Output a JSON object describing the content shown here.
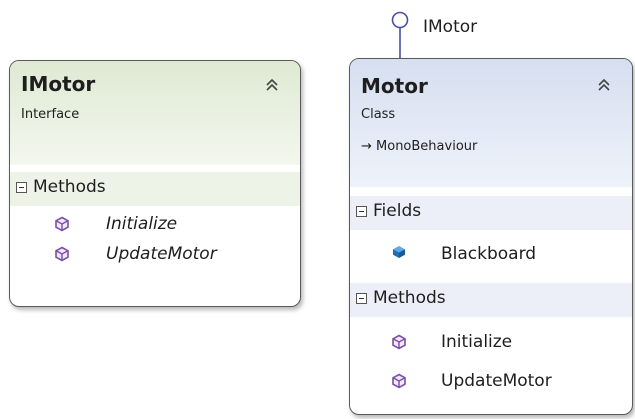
{
  "lollipop": {
    "label": "IMotor"
  },
  "imotor": {
    "name": "IMotor",
    "stereotype": "Interface",
    "methods": {
      "label": "Methods",
      "items": [
        "Initialize",
        "UpdateMotor"
      ]
    }
  },
  "motor": {
    "name": "Motor",
    "stereotype": "Class",
    "inherits": "→ MonoBehaviour",
    "fields": {
      "label": "Fields",
      "items": [
        "Blackboard"
      ]
    },
    "methods": {
      "label": "Methods",
      "items": [
        "Initialize",
        "UpdateMotor"
      ]
    }
  },
  "colors": {
    "interface_header": "#dfe9d3",
    "class_header": "#d6dff0",
    "method_icon": "#7b4ea8",
    "field_icon": "#1f6fb5",
    "lollipop": "#4a4fa5"
  },
  "icons": {
    "collapse": "double-chevron-up-icon",
    "method": "method-cube-icon",
    "field": "field-icon"
  }
}
